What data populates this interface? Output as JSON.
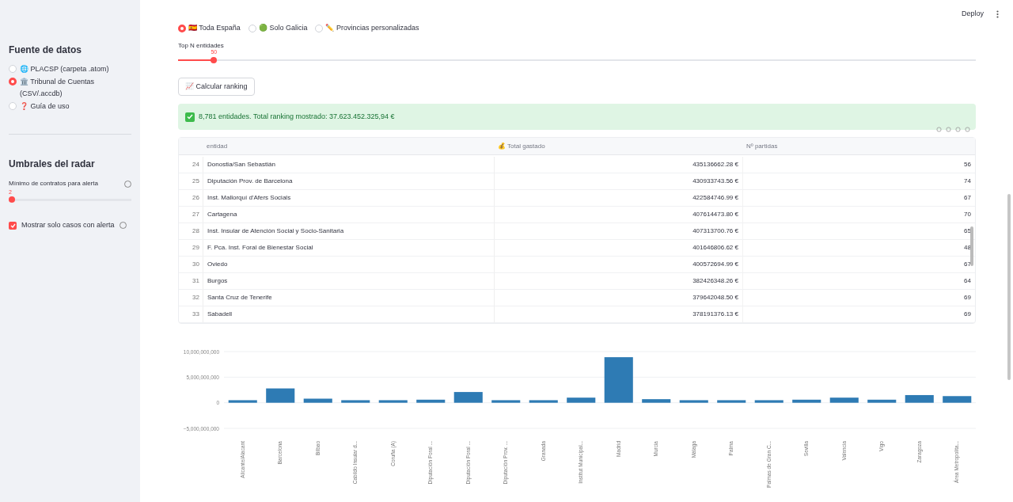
{
  "header": {
    "deploy": "Deploy"
  },
  "sidebar": {
    "source_title": "Fuente de datos",
    "sources": [
      {
        "label": "🌐 PLACSP (carpeta .atom)",
        "selected": false
      },
      {
        "label": "🏛️ Tribunal de Cuentas (CSV/.accdb)",
        "selected": true
      },
      {
        "label": "❓ Guía de uso",
        "selected": false
      }
    ],
    "radar_title": "Umbrales del radar",
    "min_slider": {
      "label": "Mínimo de contratos para alerta",
      "value": "2",
      "level": 0
    },
    "alert_checkbox": {
      "label": "Mostrar solo casos con alerta",
      "checked": true
    }
  },
  "scope": [
    {
      "label": "🇪🇸 Toda España",
      "selected": true
    },
    {
      "label": "🟢 Solo Galicia",
      "selected": false
    },
    {
      "label": "✏️ Provincias personalizadas",
      "selected": false
    }
  ],
  "top_n": {
    "label": "Top N entidades",
    "value": "50",
    "level": 0.045
  },
  "calc_button": "📈 Calcular ranking",
  "success": "8,781 entidades. Total ranking mostrado: 37.623.452.325,94 €",
  "table": {
    "columns": [
      "",
      "entidad",
      "💰 Total gastado",
      "Nº partidas"
    ],
    "rows": [
      [
        "24",
        "Donostia/San Sebastián",
        "435136662.28 €",
        "56"
      ],
      [
        "25",
        "Diputación Prov. de Barcelona",
        "430933743.56 €",
        "74"
      ],
      [
        "26",
        "Inst. Mallorquí d'Afers Socials",
        "422584746.99 €",
        "67"
      ],
      [
        "27",
        "Cartagena",
        "407614473.80 €",
        "70"
      ],
      [
        "28",
        "Inst. Insular de Atención Social y Socio-Sanitaria",
        "407313700.76 €",
        "65"
      ],
      [
        "29",
        "F. Pca. Inst. Foral de Bienestar Social",
        "401646806.62 €",
        "48"
      ],
      [
        "30",
        "Oviedo",
        "400572694.99 €",
        "67"
      ],
      [
        "31",
        "Burgos",
        "382426348.26 €",
        "64"
      ],
      [
        "32",
        "Santa Cruz de Tenerife",
        "379642048.50 €",
        "69"
      ],
      [
        "33",
        "Sabadell",
        "378191376.13 €",
        "69"
      ]
    ]
  },
  "chart": {
    "chart_data": {
      "type": "bar",
      "categories": [
        "Alicante/Alacant",
        "Barcelona",
        "Bilbao",
        "Cabildo Insular d...",
        "Coruña (A)",
        "Diputación Foral ...",
        "Diputación Foral ...",
        "Diputación Prov. ...",
        "Granada",
        "Institut Municipal...",
        "Madrid",
        "Murcia",
        "Málaga",
        "Palma",
        "Palmas de Gran C...",
        "Sevilla",
        "Valencia",
        "Vigo",
        "Zaragoza",
        "Área Metropolita..."
      ],
      "series": [
        {
          "color": "#2e7bb4",
          "values": [
            500000000,
            2800000000,
            800000000,
            500000000,
            500000000,
            600000000,
            2100000000,
            500000000,
            500000000,
            1000000000,
            8900000000,
            700000000,
            500000000,
            500000000,
            500000000,
            600000000,
            1000000000,
            600000000,
            1500000000,
            1300000000
          ]
        }
      ],
      "ylim": [
        -5000000000,
        10000000000
      ],
      "yticks": [
        {
          "value": 10000000000,
          "label": "10,000,000,000"
        },
        {
          "value": 5000000000,
          "label": "5,000,000,000"
        },
        {
          "value": 0,
          "label": "0"
        },
        {
          "value": -5000000000,
          "label": "−5,000,000,000"
        }
      ]
    }
  }
}
